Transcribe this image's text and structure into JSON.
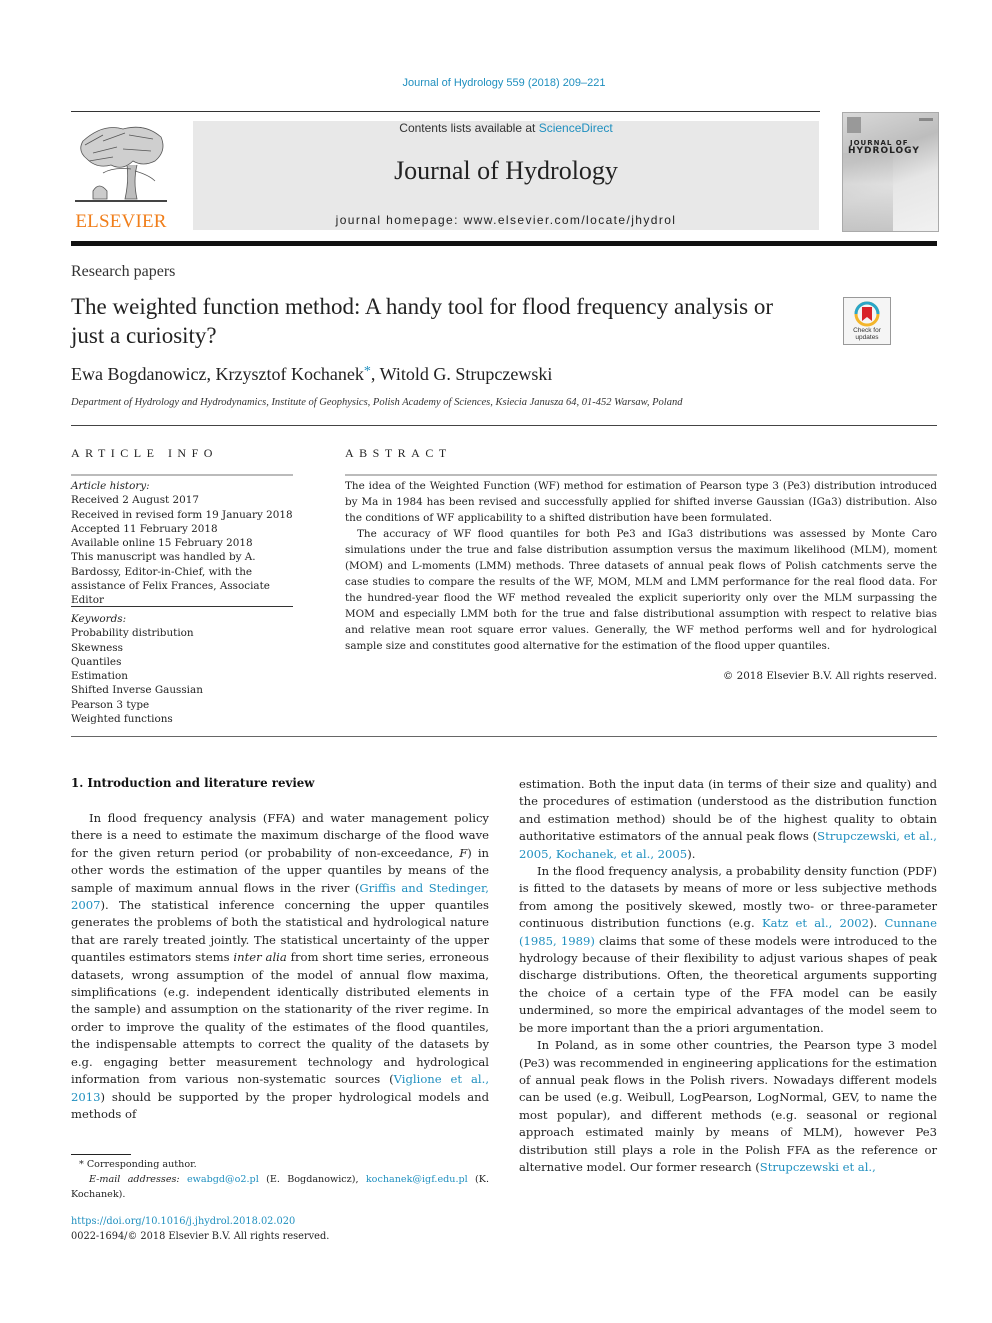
{
  "header": {
    "citation": "Journal of Hydrology 559 (2018) 209–221",
    "contents_prefix": "Contents lists available at ",
    "contents_link": "ScienceDirect",
    "journal_title": "Journal of Hydrology",
    "homepage": "journal homepage: www.elsevier.com/locate/jhydrol",
    "publisher_logo_text": "ELSEVIER",
    "cover_title_line1": "JOURNAL OF",
    "cover_title_line2": "HYDROLOGY",
    "check_updates_line1": "Check for",
    "check_updates_line2": "updates"
  },
  "colors": {
    "link": "#1f8fbf",
    "elsevier_orange": "#f07e1a",
    "banner_grey": "#e8e8e8"
  },
  "article": {
    "section": "Research papers",
    "title": "The weighted function method: A handy tool for flood frequency analysis or just a curiosity?",
    "authors": [
      {
        "name": "Ewa Bogdanowicz",
        "sep": ", "
      },
      {
        "name": "Krzysztof Kochanek",
        "mark": "*",
        "sep": ", "
      },
      {
        "name": "Witold G. Strupczewski",
        "sep": ""
      }
    ],
    "affiliation": "Department of Hydrology and Hydrodynamics, Institute of Geophysics, Polish Academy of Sciences, Ksiecia Janusza 64, 01-452 Warsaw, Poland"
  },
  "article_info": {
    "heading": "ARTICLE INFO",
    "history_label": "Article history:",
    "history": [
      "Received 2 August 2017",
      "Received in revised form 19 January 2018",
      "Accepted 11 February 2018",
      "Available online 15 February 2018",
      "This manuscript was handled by A. Bardossy, Editor-in-Chief, with the assistance of Felix Frances, Associate Editor"
    ],
    "keywords_label": "Keywords:",
    "keywords": [
      "Probability distribution",
      "Skewness",
      "Quantiles",
      "Estimation",
      "Shifted Inverse Gaussian",
      "Pearson 3 type",
      "Weighted functions"
    ]
  },
  "abstract": {
    "heading": "ABSTRACT",
    "paragraphs": [
      "The idea of the Weighted Function (WF) method for estimation of Pearson type 3 (Pe3) distribution introduced by Ma in 1984 has been revised and successfully applied for shifted inverse Gaussian (IGa3) distribution. Also the conditions of WF applicability to a shifted distribution have been formulated.",
      "The accuracy of WF flood quantiles for both Pe3 and IGa3 distributions was assessed by Monte Caro simulations under the true and false distribution assumption versus the maximum likelihood (MLM), moment (MOM) and L-moments (LMM) methods. Three datasets of annual peak flows of Polish catchments serve the case studies to compare the results of the WF, MOM, MLM and LMM performance for the real flood data. For the hundred-year flood the WF method revealed the explicit superiority only over the MLM surpassing the MOM and especially LMM both for the true and false distributional assumption with respect to relative bias and relative mean root square error values. Generally, the WF method performs well and for hydrological sample size and constitutes good alternative for the estimation of the flood upper quantiles."
    ],
    "copyright": "© 2018 Elsevier B.V. All rights reserved."
  },
  "body": {
    "section_heading": "1. Introduction and literature review",
    "col1_paragraph": [
      {
        "t": "In flood frequency analysis (FFA) and water management policy there is a need to estimate the maximum discharge of the flood wave for the given return period (or probability of non-exceedance, "
      },
      {
        "t": "F",
        "style": "italic"
      },
      {
        "t": ") in other words the estimation of the upper quantiles by means of the sample of maximum annual flows in the river ("
      },
      {
        "t": "Griffis and Stedinger, 2007",
        "style": "link"
      },
      {
        "t": "). The statistical inference concerning the upper quantiles generates the problems of both the statistical and hydrological nature that are rarely treated jointly. The statistical uncertainty of the upper quantiles estimators stems "
      },
      {
        "t": "inter alia",
        "style": "italic"
      },
      {
        "t": " from short time series, erroneous datasets, wrong assumption of the model of annual flow maxima, simplifications (e.g. independent identically distributed elements in the sample) and assumption on the stationarity of the river regime. In order to improve the quality of the estimates of the flood quantiles, the indispensable attempts to correct the quality of the datasets by e.g. engaging better measurement technology and hydrological information from various non-systematic sources ("
      },
      {
        "t": "Viglione et al., 2013",
        "style": "link"
      },
      {
        "t": ") should be supported by the proper hydrological models and methods of"
      }
    ],
    "col2_paragraphs": [
      [
        {
          "t": "estimation. Both the input data (in terms of their size and quality) and the procedures of estimation (understood as the distribution function and estimation method) should be of the highest quality to obtain authoritative estimators of the annual peak flows ("
        },
        {
          "t": "Strupczewski, et al., 2005, Kochanek, et al., 2005",
          "style": "link"
        },
        {
          "t": ")."
        }
      ],
      [
        {
          "t": "In the flood frequency analysis, a probability density function (PDF) is fitted to the datasets by means of more or less subjective methods from among the positively skewed, mostly two- or three-parameter continuous distribution functions (e.g. "
        },
        {
          "t": "Katz et al., 2002",
          "style": "link"
        },
        {
          "t": "). "
        },
        {
          "t": "Cunnane (1985, 1989)",
          "style": "link"
        },
        {
          "t": " claims that some of these models were introduced to the hydrology because of their flexibility to adjust various shapes of peak discharge distributions. Often, the theoretical arguments supporting the choice of a certain type of the FFA model can be easily undermined, so more the empirical advantages of the model seem to be more important than the a priori argumentation."
        }
      ],
      [
        {
          "t": "In Poland, as in some other countries, the Pearson type 3 model (Pe3) was recommended in engineering applications for the estimation of annual peak flows in the Polish rivers. Nowadays different models can be used (e.g. Weibull, LogPearson, LogNormal, GEV, to name the most popular), and different methods (e.g. seasonal or regional approach estimated mainly by means of MLM), however Pe3 distribution still plays a role in the Polish FFA as the reference or alternative model. Our former research ("
        },
        {
          "t": "Strupczewski et al.,",
          "style": "link"
        }
      ]
    ]
  },
  "footnotes": {
    "corresponding": "* Corresponding author.",
    "email_label": "E-mail addresses:",
    "email1": "ewabgd@o2.pl",
    "email1_owner": " (E. Bogdanowicz), ",
    "email2": "kochanek@igf.edu.pl",
    "email2_owner": " (K. Kochanek).",
    "doi": "https://doi.org/10.1016/j.jhydrol.2018.02.020",
    "issn": "0022-1694/© 2018 Elsevier B.V. All rights reserved."
  }
}
